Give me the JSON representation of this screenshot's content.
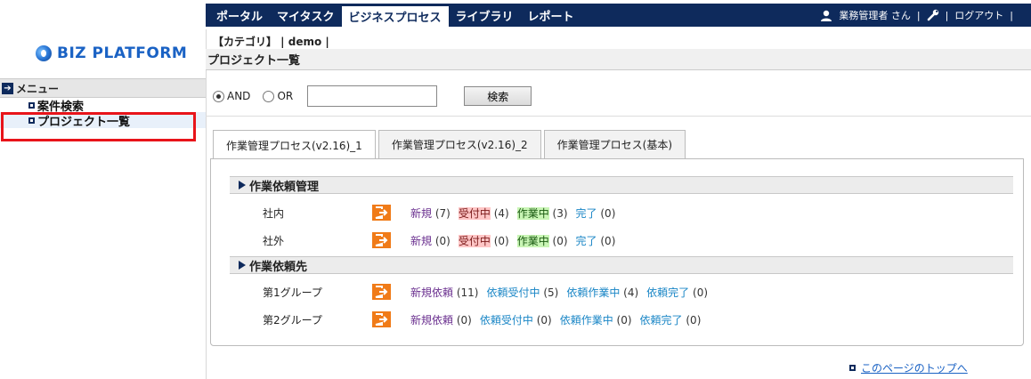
{
  "nav": {
    "tabs": [
      {
        "label": "ポータル",
        "active": false
      },
      {
        "label": "マイタスク",
        "active": false
      },
      {
        "label": "ビジネスプロセス",
        "active": true
      },
      {
        "label": "ライブラリ",
        "active": false
      },
      {
        "label": "レポート",
        "active": false
      }
    ],
    "user": "業務管理者 さん",
    "logout": "ログアウト"
  },
  "brand": {
    "logo_text": "BIZ PLATFORM"
  },
  "sidebar": {
    "heading": "メニュー",
    "items": [
      {
        "label": "案件検索",
        "selected": false
      },
      {
        "label": "プロジェクト一覧",
        "selected": true
      }
    ]
  },
  "breadcrumb": "【カテゴリ】 | demo |",
  "page_title": "プロジェクト一覧",
  "search": {
    "and_label": "AND",
    "or_label": "OR",
    "mode": "AND",
    "query": "",
    "button": "検索"
  },
  "tabs": [
    {
      "label": "作業管理プロセス(v2.16)_1",
      "active": true
    },
    {
      "label": "作業管理プロセス(v2.16)_2",
      "active": false
    },
    {
      "label": "作業管理プロセス(基本)",
      "active": false
    }
  ],
  "sections": [
    {
      "title": "作業依頼管理",
      "rows": [
        {
          "label": "社内",
          "stats": [
            {
              "label": "新規",
              "count": "(7)",
              "style": "purple"
            },
            {
              "label": "受付中",
              "count": "(4)",
              "style": "pink"
            },
            {
              "label": "作業中",
              "count": "(3)",
              "style": "green"
            },
            {
              "label": "完了",
              "count": "(0)",
              "style": "blue"
            }
          ]
        },
        {
          "label": "社外",
          "stats": [
            {
              "label": "新規",
              "count": "(0)",
              "style": "purple"
            },
            {
              "label": "受付中",
              "count": "(0)",
              "style": "pink"
            },
            {
              "label": "作業中",
              "count": "(0)",
              "style": "green"
            },
            {
              "label": "完了",
              "count": "(0)",
              "style": "blue"
            }
          ]
        }
      ]
    },
    {
      "title": "作業依頼先",
      "rows": [
        {
          "label": "第1グループ",
          "stats": [
            {
              "label": "新規依頼",
              "count": "(11)",
              "style": "purple"
            },
            {
              "label": "依頼受付中",
              "count": "(5)",
              "style": "blue"
            },
            {
              "label": "依頼作業中",
              "count": "(4)",
              "style": "blue"
            },
            {
              "label": "依頼完了",
              "count": "(0)",
              "style": "blue"
            }
          ]
        },
        {
          "label": "第2グループ",
          "stats": [
            {
              "label": "新規依頼",
              "count": "(0)",
              "style": "purple"
            },
            {
              "label": "依頼受付中",
              "count": "(0)",
              "style": "blue"
            },
            {
              "label": "依頼作業中",
              "count": "(0)",
              "style": "blue"
            },
            {
              "label": "依頼完了",
              "count": "(0)",
              "style": "blue"
            }
          ]
        }
      ]
    }
  ],
  "footer": {
    "top_link": "このページのトップへ"
  },
  "colors": {
    "nav_bg": "#0e2a5c",
    "accent_orange": "#f07b18",
    "highlight_red": "#e8141a"
  }
}
